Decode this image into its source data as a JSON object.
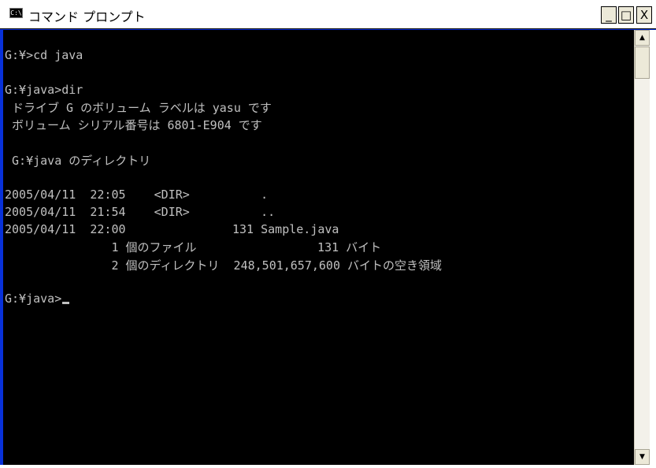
{
  "window": {
    "title": "コマンド プロンプト",
    "icon_text": "C:\\",
    "buttons": {
      "minimize": "_",
      "maximize": "□",
      "close": "X"
    }
  },
  "console": {
    "lines": [
      "",
      "G:¥>cd java",
      "",
      "G:¥java>dir",
      " ドライブ G のボリューム ラベルは yasu です",
      " ボリューム シリアル番号は 6801-E904 です",
      "",
      " G:¥java のディレクトリ",
      "",
      "2005/04/11  22:05    <DIR>          .",
      "2005/04/11  21:54    <DIR>          ..",
      "2005/04/11  22:00               131 Sample.java",
      "               1 個のファイル                 131 バイト",
      "               2 個のディレクトリ  248,501,657,600 バイトの空き領域",
      "",
      "G:¥java>"
    ]
  },
  "scrollbar": {
    "up_arrow": "▲",
    "down_arrow": "▼"
  },
  "icons": {
    "window_icon": "cmd-icon"
  }
}
